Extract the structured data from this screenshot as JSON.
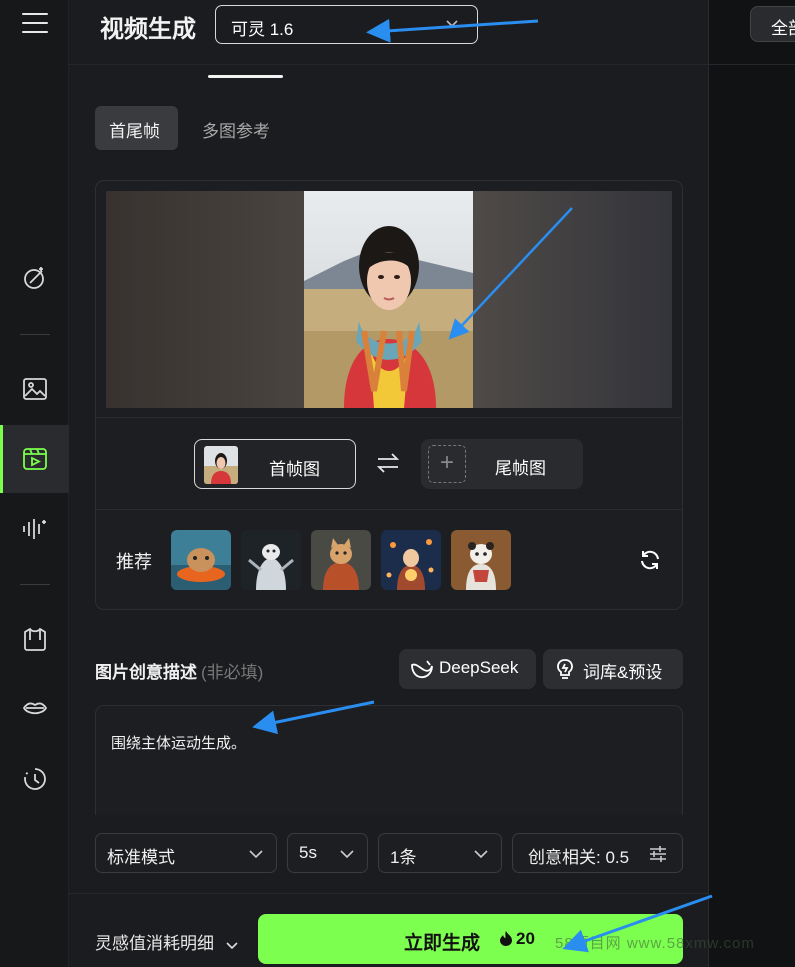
{
  "app": {
    "title": "视频生成",
    "model": "可灵 1.6",
    "right_button": "全部"
  },
  "sidebar": {
    "items": [
      {
        "icon": "magic-wand-icon"
      },
      {
        "icon": "image-icon"
      },
      {
        "icon": "video-icon",
        "active": true
      },
      {
        "icon": "audio-wave-icon"
      },
      {
        "icon": "shirt-icon"
      },
      {
        "icon": "lips-icon"
      },
      {
        "icon": "history-clock-icon"
      }
    ]
  },
  "tabs": [
    {
      "label": "首尾帧",
      "active": true
    },
    {
      "label": "多图参考",
      "active": false
    }
  ],
  "frames": {
    "first_label": "首帧图",
    "last_label": "尾帧图"
  },
  "recommend": {
    "label": "推荐"
  },
  "description": {
    "label": "图片创意描述",
    "optional": "(非必填)",
    "deepseek": "DeepSeek",
    "lexicon": "词库&预设",
    "text": "围绕主体运动生成。"
  },
  "options": {
    "mode": "标准模式",
    "duration": "5s",
    "count": "1条",
    "creativity": "创意相关: 0.5"
  },
  "footer": {
    "cost_detail": "灵感值消耗明细",
    "generate": "立即生成",
    "cost": "20"
  },
  "watermark": "58项目网 www.58xmw.com",
  "colors": {
    "accent": "#7dff4f",
    "annotation_arrow": "#2a8df0"
  }
}
